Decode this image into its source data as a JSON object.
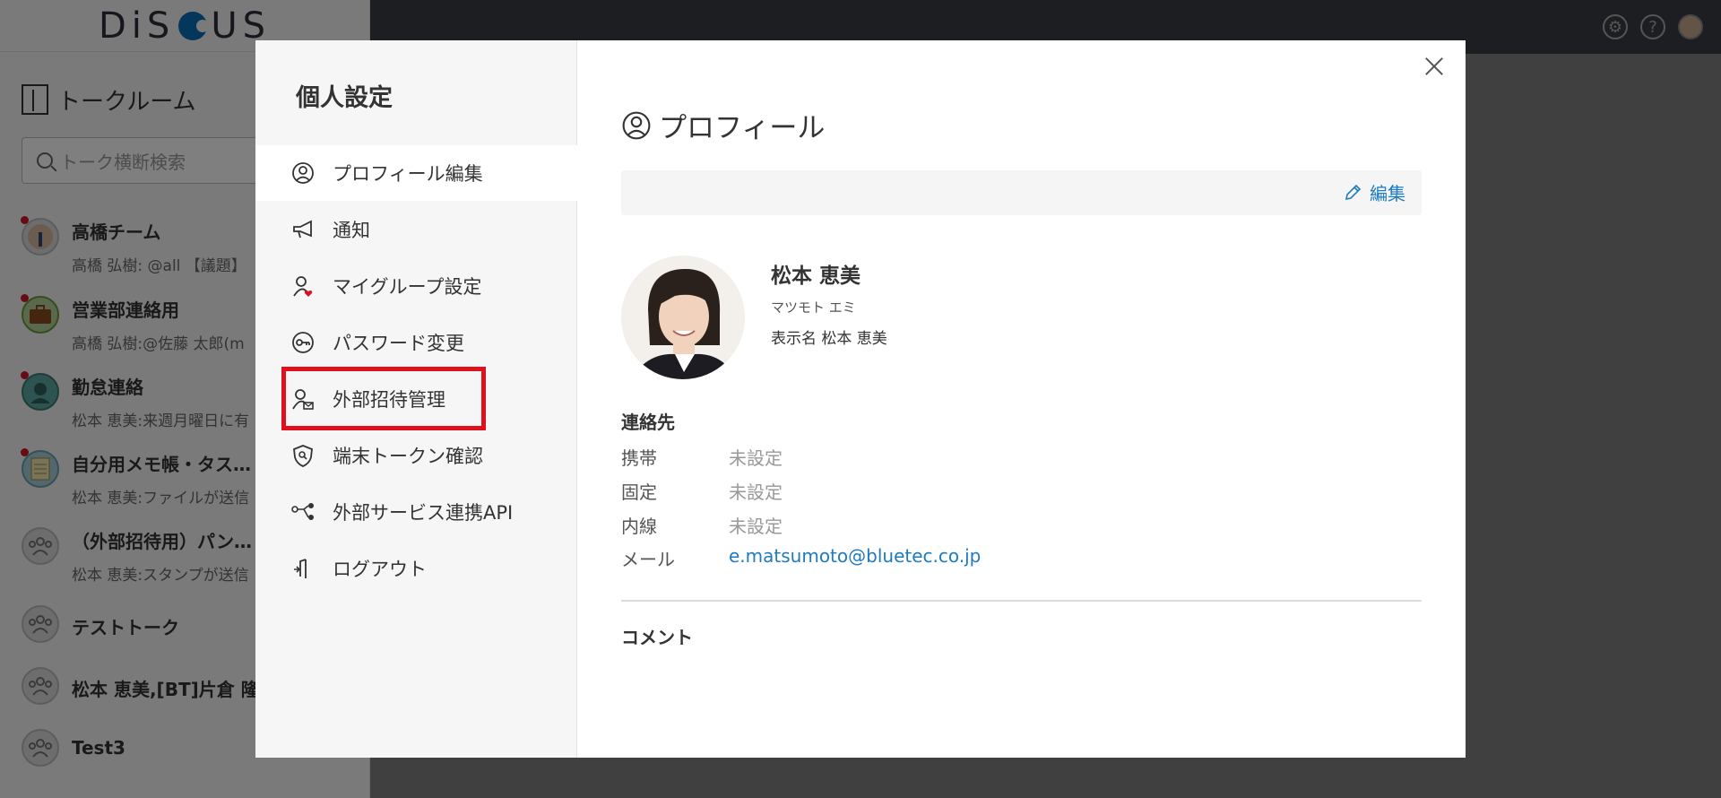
{
  "app": {
    "logo_text": "DiSCUS",
    "room_header": "トークルーム",
    "search_placeholder": "トーク横断検索",
    "rooms": [
      {
        "name": "高橋チーム",
        "last": "高橋 弘樹: @all 【議題】"
      },
      {
        "name": "営業部連絡用",
        "last": "高橋 弘樹:@佐藤 太郎(m"
      },
      {
        "name": "勤怠連絡",
        "last": "松本 恵美:来週月曜日に有"
      },
      {
        "name": "自分用メモ帳・タス…",
        "last": "松本 恵美:ファイルが送信"
      },
      {
        "name": "（外部招待用）パン…",
        "last": "松本 恵美:スタンプが送信"
      },
      {
        "name": "テストトーク",
        "last": ""
      },
      {
        "name": "松本 恵美,[BT]片倉 隆",
        "last": ""
      },
      {
        "name": "Test3",
        "last": ""
      }
    ]
  },
  "modal": {
    "title": "個人設定",
    "nav": [
      {
        "label": "プロフィール編集",
        "icon": "user-circle-icon"
      },
      {
        "label": "通知",
        "icon": "megaphone-icon"
      },
      {
        "label": "マイグループ設定",
        "icon": "user-heart-icon"
      },
      {
        "label": "パスワード変更",
        "icon": "key-icon"
      },
      {
        "label": "外部招待管理",
        "icon": "user-mail-icon"
      },
      {
        "label": "端末トークン確認",
        "icon": "shield-icon"
      },
      {
        "label": "外部サービス連携API",
        "icon": "api-nodes-icon"
      },
      {
        "label": "ログアウト",
        "icon": "logout-icon"
      }
    ],
    "section_title": "プロフィール",
    "edit_label": "編集",
    "profile": {
      "name": "松本 恵美",
      "kana": "マツモト エミ",
      "display_name_label": "表示名",
      "display_name": "松本 恵美"
    },
    "contact": {
      "title": "連絡先",
      "rows": [
        {
          "label": "携帯",
          "value": "未設定"
        },
        {
          "label": "固定",
          "value": "未設定"
        },
        {
          "label": "内線",
          "value": "未設定"
        },
        {
          "label": "メール",
          "value": "e.matsumoto@bluetec.co.jp"
        }
      ]
    },
    "comment_title": "コメント"
  },
  "colors": {
    "accent": "#1e7bc0",
    "highlight": "#e0111c",
    "unread_dot": "#d0162b"
  }
}
